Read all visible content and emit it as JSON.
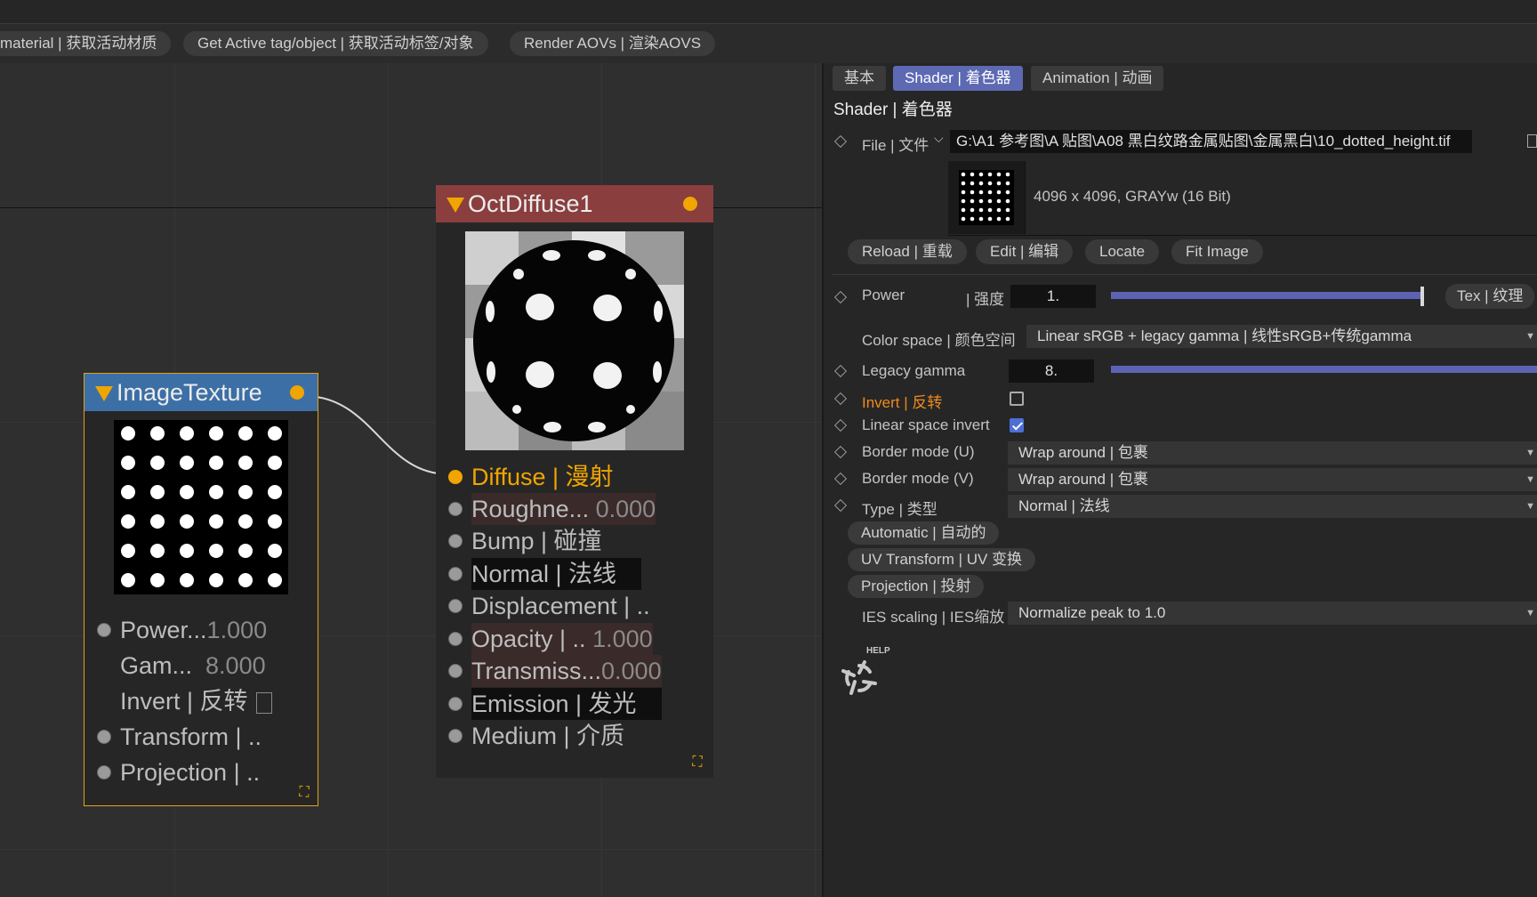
{
  "toolbar": {
    "btn_material": "material | 获取活动材质",
    "btn_active": "Get Active tag/object | 获取活动标签/对象",
    "btn_aovs": "Render AOVs | 渲染AOVS"
  },
  "nodes": {
    "diffuse": {
      "title": "OctDiffuse1",
      "ports": [
        {
          "label": "Diffuse | 漫射",
          "value": ""
        },
        {
          "label": "Roughne...",
          "value": "0.000"
        },
        {
          "label": "Bump | 碰撞",
          "value": ""
        },
        {
          "label": "Normal | 法线",
          "value": ""
        },
        {
          "label": "Displacement | ..",
          "value": ""
        },
        {
          "label": "Opacity | ..",
          "value": "1.000"
        },
        {
          "label": "Transmiss...",
          "value": "0.000"
        },
        {
          "label": "Emission | 发光",
          "value": ""
        },
        {
          "label": "Medium | 介质",
          "value": ""
        }
      ]
    },
    "texture": {
      "title": "ImageTexture",
      "ports": [
        {
          "label": "Power...",
          "value": "1.000"
        },
        {
          "label": "Gam...",
          "value": "8.000"
        },
        {
          "label": "Invert | 反转",
          "value": ""
        },
        {
          "label": "Transform | ..",
          "value": ""
        },
        {
          "label": "Projection | ..",
          "value": ""
        }
      ]
    }
  },
  "panel": {
    "tabs": [
      "基本",
      "Shader | 着色器",
      "Animation | 动画"
    ],
    "title": "Shader | 着色器",
    "file_label": "File | 文件",
    "file_path": "G:\\A1 参考图\\A 贴图\\A08 黑白纹路金属贴图\\金属黑白\\10_dotted_height.tif",
    "image_info": "4096 x 4096, GRAYw (16 Bit)",
    "buttons": [
      "Reload | 重载",
      "Edit | 编辑",
      "Locate",
      "Fit Image"
    ],
    "power_label": "Power",
    "power_label2": "| 强度",
    "power_value": "1.",
    "power_level": 1.0,
    "tex_button": "Tex | 纹理",
    "colorspace_label": "Color space | 颜色空间",
    "colorspace_value": "Linear sRGB + legacy gamma | 线性sRGB+传统gamma",
    "gamma_label": "Legacy gamma",
    "gamma_value": "8.",
    "invert_label": "Invert | 反转",
    "invert_checked": false,
    "linear_invert_label": "Linear space invert",
    "linear_invert_checked": true,
    "border_u_label": "Border mode (U)",
    "border_u_value": "Wrap around | 包裹",
    "border_v_label": "Border mode (V)",
    "border_v_value": "Wrap around | 包裹",
    "type_label": "Type | 类型",
    "type_value": "Normal | 法线",
    "sections": [
      "Automatic | 自动的",
      "UV Transform | UV 变换",
      "Projection | 投射"
    ],
    "ies_label": "IES scaling | IES缩放",
    "ies_value": "Normalize peak to 1.0",
    "help_label": "HELP"
  },
  "colors": {
    "accent": "#f0a500",
    "tab_active": "#5d69b3",
    "diffuse_header": "#8a3e3e",
    "texture_header": "#3c6fa6",
    "slider": "#5d63b4",
    "invert_label": "#f08a1c"
  }
}
